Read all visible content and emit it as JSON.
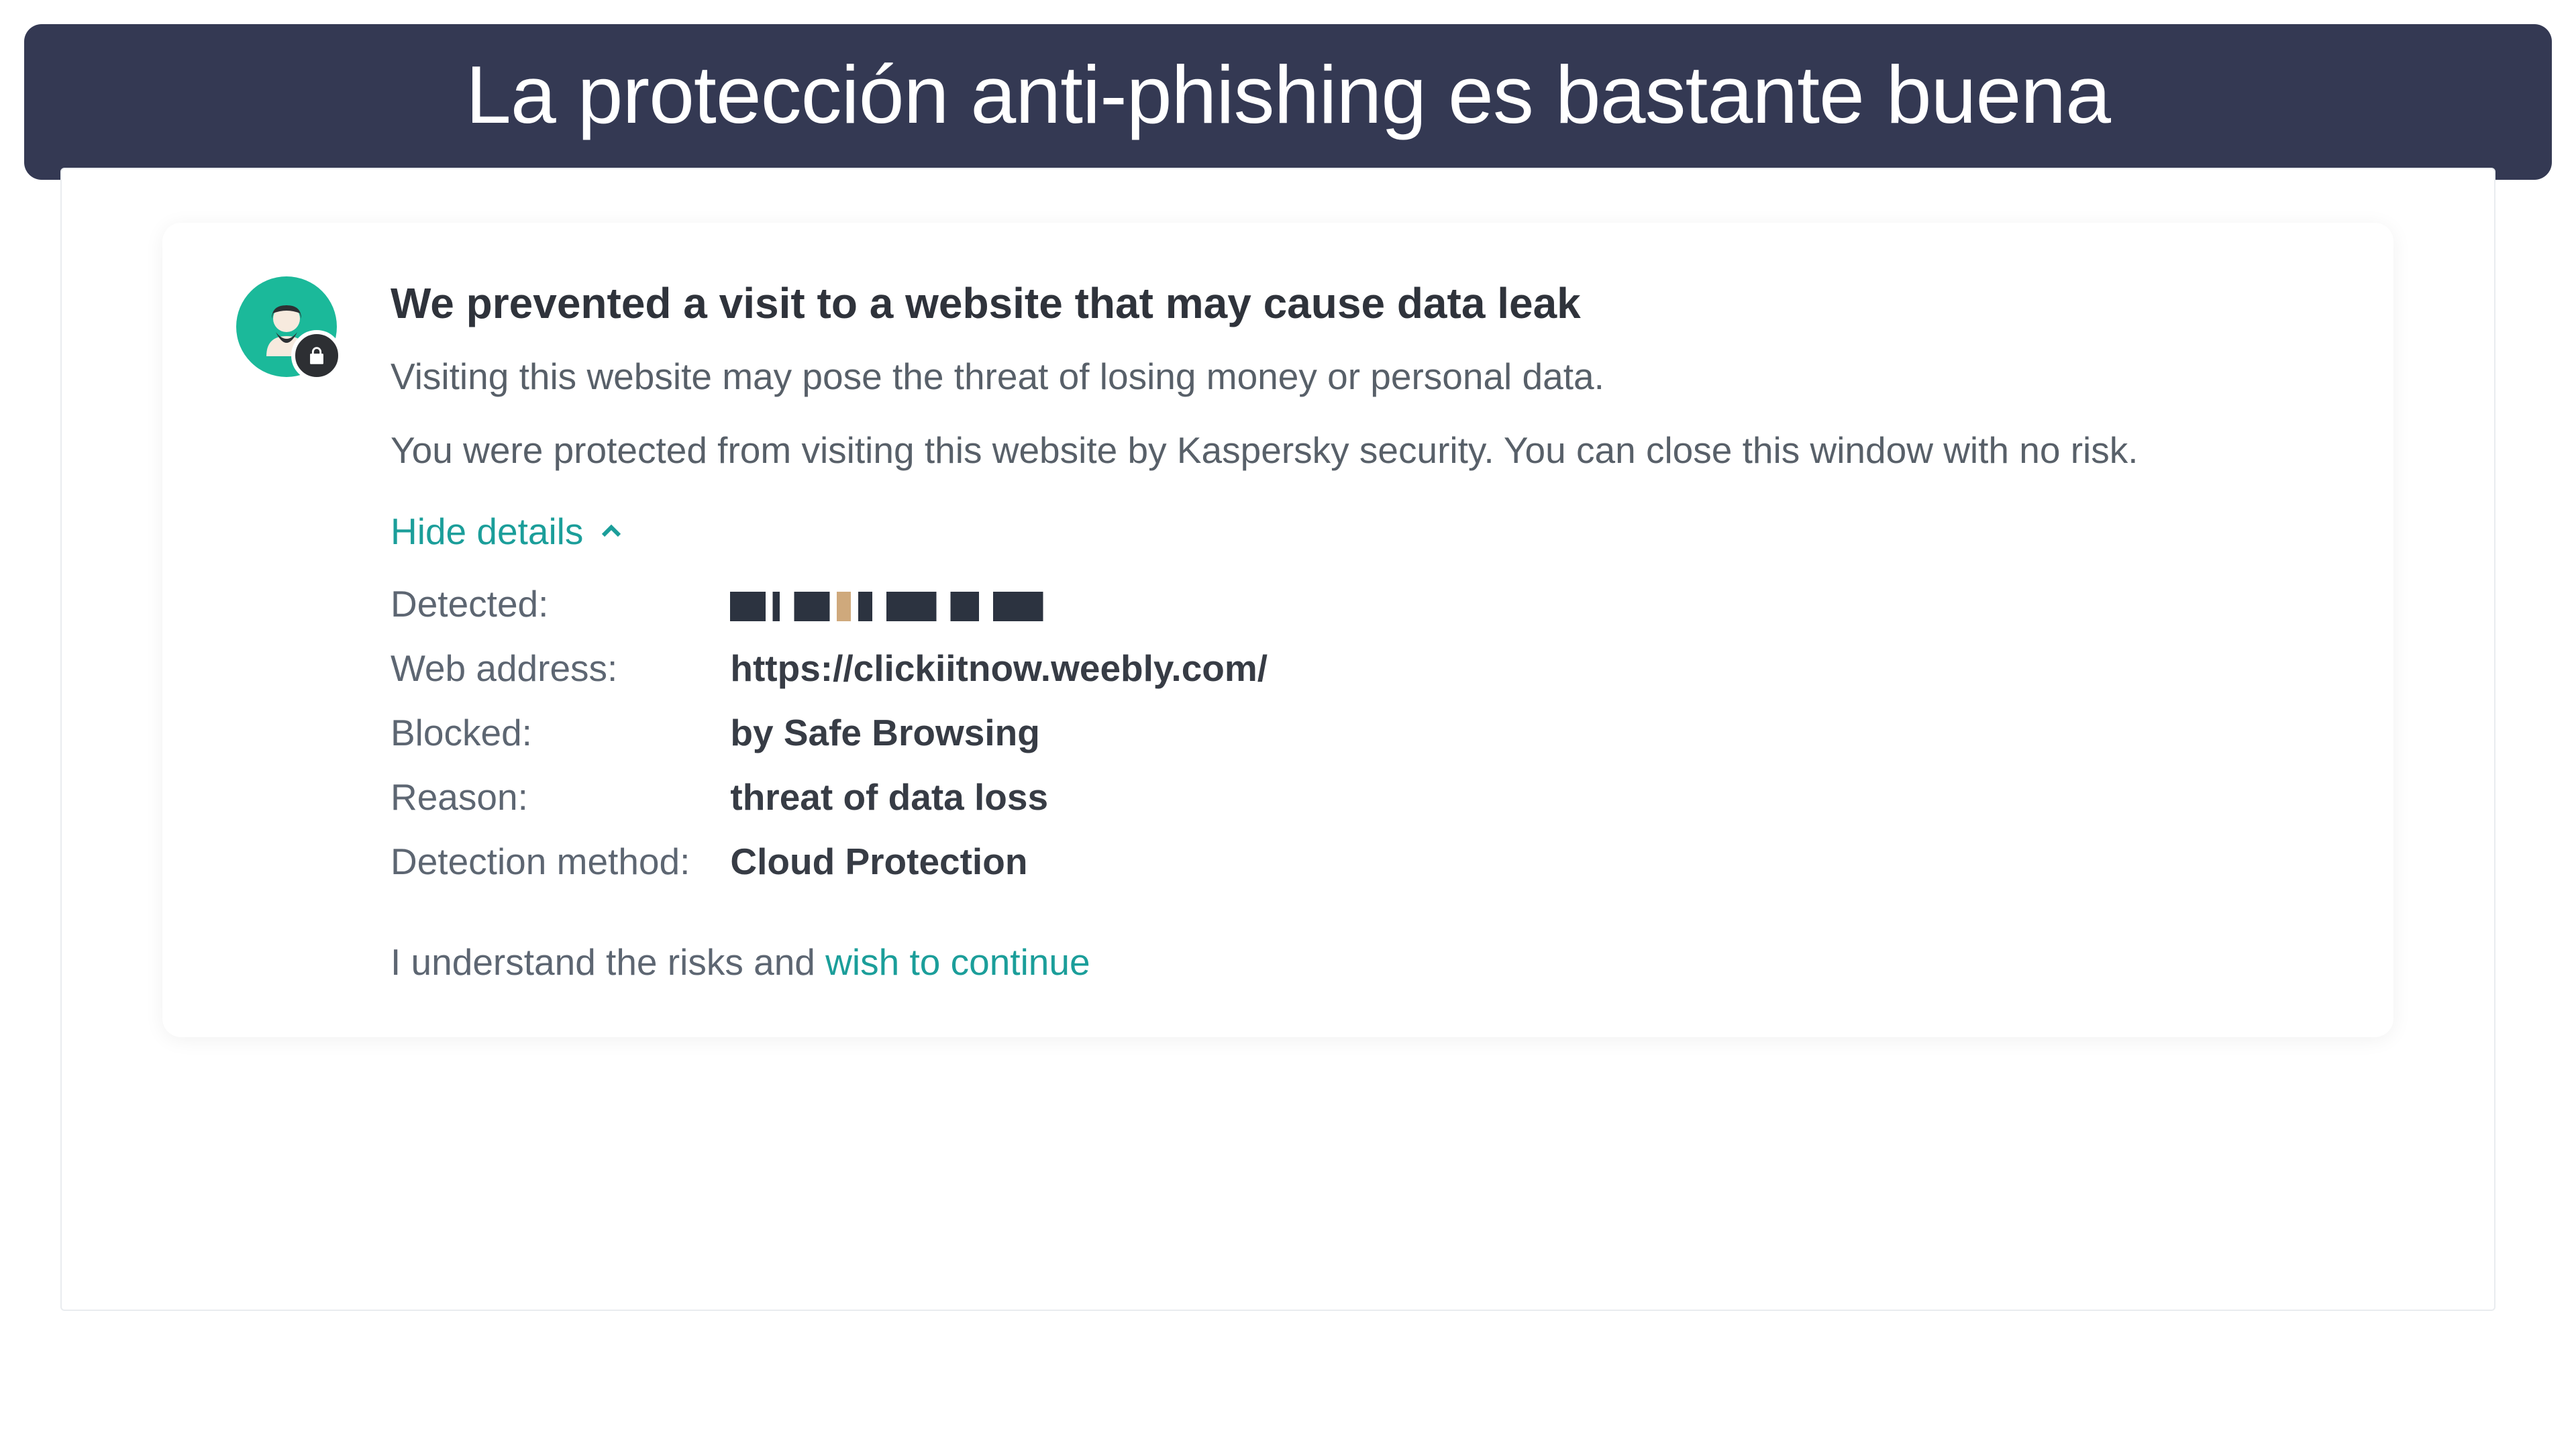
{
  "banner": {
    "title": "La protección anti-phishing es bastante buena"
  },
  "card": {
    "title": "We prevented a visit to a website that may cause data leak",
    "para1": "Visiting this website may pose the threat of losing money or personal data.",
    "para2": "You were protected from visiting this website by Kaspersky security. You can close this window with no risk.",
    "toggle_label": "Hide details",
    "detail_labels": {
      "detected": "Detected:",
      "web_address": "Web address:",
      "blocked": "Blocked:",
      "reason": "Reason:",
      "method": "Detection method:"
    },
    "detail_values": {
      "web_address": "https://clickiitnow.weebly.com/",
      "blocked": "by Safe Browsing",
      "reason": "threat of data loss",
      "method": "Cloud Protection"
    },
    "risks_prefix": "I understand the risks and ",
    "risks_link": "wish to continue"
  }
}
